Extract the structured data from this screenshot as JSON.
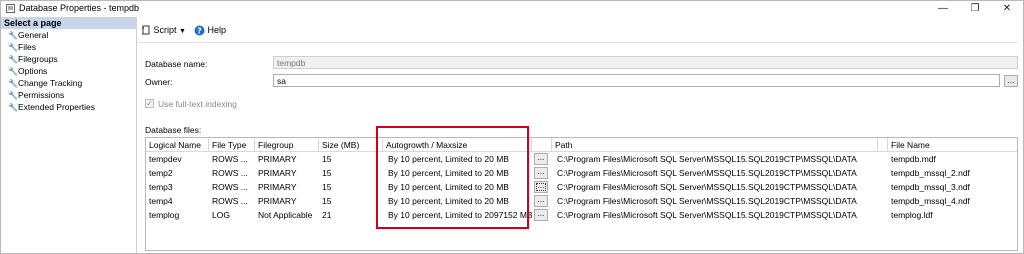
{
  "window": {
    "title": "Database Properties - tempdb",
    "minimize": "—",
    "restore": "❐",
    "close": "✕"
  },
  "sidebar": {
    "header": "Select a page",
    "items": [
      {
        "label": "General"
      },
      {
        "label": "Files"
      },
      {
        "label": "Filegroups"
      },
      {
        "label": "Options"
      },
      {
        "label": "Change Tracking"
      },
      {
        "label": "Permissions"
      },
      {
        "label": "Extended Properties"
      }
    ]
  },
  "toolbar": {
    "script_label": "Script",
    "help_label": "Help"
  },
  "form": {
    "database_name_label": "Database name:",
    "database_name_value": "tempdb",
    "owner_label": "Owner:",
    "owner_value": "sa",
    "fulltext_label": "Use full-text indexing",
    "database_files_label": "Database files:"
  },
  "grid": {
    "columns": [
      "Logical Name",
      "File Type",
      "Filegroup",
      "Size (MB)",
      "Autogrowth / Maxsize",
      "",
      "Path",
      "",
      "File Name"
    ],
    "rows": [
      [
        "tempdev",
        "ROWS ...",
        "PRIMARY",
        "15",
        "By 10 percent, Limited to 20 MB",
        "...",
        "C:\\Program Files\\Microsoft SQL Server\\MSSQL15.SQL2019CTP\\MSSQL\\DATA",
        "...",
        "tempdb.mdf"
      ],
      [
        "temp2",
        "ROWS ...",
        "PRIMARY",
        "15",
        "By 10 percent, Limited to 20 MB",
        "...",
        "C:\\Program Files\\Microsoft SQL Server\\MSSQL15.SQL2019CTP\\MSSQL\\DATA",
        "...",
        "tempdb_mssql_2.ndf"
      ],
      [
        "temp3",
        "ROWS ...",
        "PRIMARY",
        "15",
        "By 10 percent, Limited to 20 MB",
        "...",
        "C:\\Program Files\\Microsoft SQL Server\\MSSQL15.SQL2019CTP\\MSSQL\\DATA",
        "...",
        "tempdb_mssql_3.ndf"
      ],
      [
        "temp4",
        "ROWS ...",
        "PRIMARY",
        "15",
        "By 10 percent, Limited to 20 MB",
        "...",
        "C:\\Program Files\\Microsoft SQL Server\\MSSQL15.SQL2019CTP\\MSSQL\\DATA",
        "...",
        "tempdb_mssql_4.ndf"
      ],
      [
        "templog",
        "LOG",
        "Not Applicable",
        "21",
        "By 10 percent, Limited to 2097152 MB",
        "...",
        "C:\\Program Files\\Microsoft SQL Server\\MSSQL15.SQL2019CTP\\MSSQL\\DATA",
        "...",
        "templog.ldf"
      ]
    ]
  },
  "colors": {
    "sidebar_header_bg": "#c8d6ea",
    "highlight_border": "#d0021b"
  },
  "icons": {
    "app": "database-properties-icon",
    "page": "wrench-icon",
    "script": "script-icon",
    "help": "help-icon"
  }
}
